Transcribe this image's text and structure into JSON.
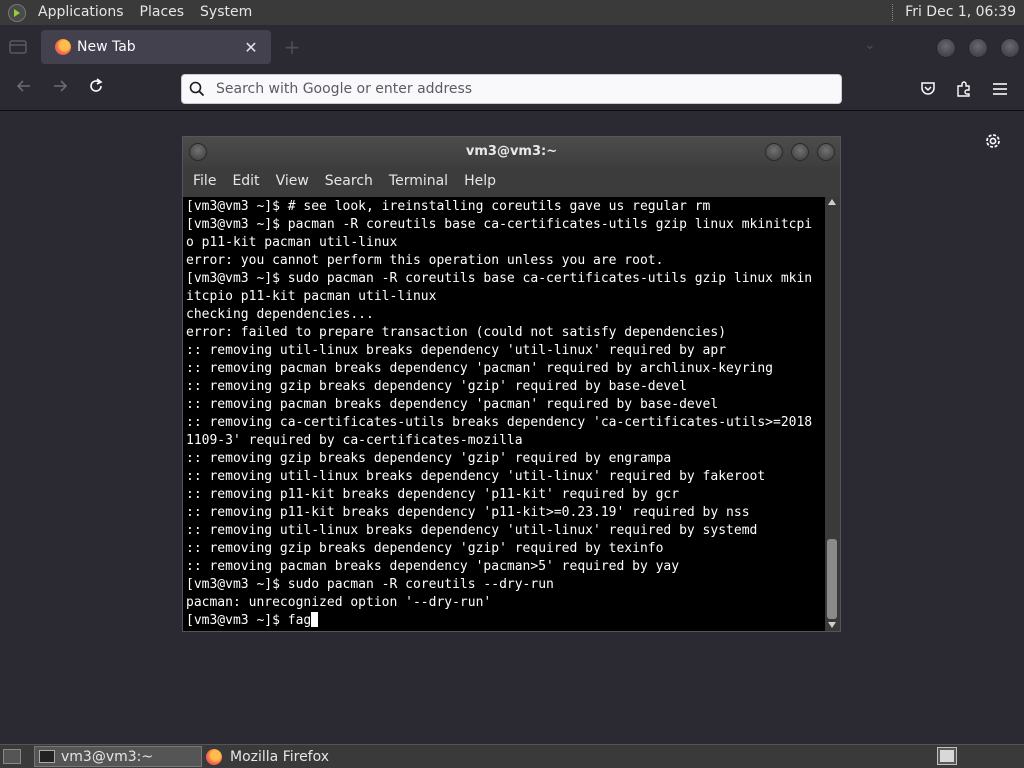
{
  "top_panel": {
    "menus": [
      "Applications",
      "Places",
      "System"
    ],
    "clock": "Fri Dec 1, 06:39"
  },
  "browser": {
    "tab_title": "New Tab",
    "urlbar_placeholder": "Search with Google or enter address"
  },
  "terminal": {
    "title": "vm3@vm3:~",
    "menu": [
      "File",
      "Edit",
      "View",
      "Search",
      "Terminal",
      "Help"
    ],
    "lines": [
      "[vm3@vm3 ~]$ # see look, ireinstalling coreutils gave us regular rm",
      "[vm3@vm3 ~]$ pacman -R coreutils base ca-certificates-utils gzip linux mkinitcpi",
      "o p11-kit pacman util-linux",
      "error: you cannot perform this operation unless you are root.",
      "[vm3@vm3 ~]$ sudo pacman -R coreutils base ca-certificates-utils gzip linux mkin",
      "itcpio p11-kit pacman util-linux",
      "checking dependencies...",
      "error: failed to prepare transaction (could not satisfy dependencies)",
      ":: removing util-linux breaks dependency 'util-linux' required by apr",
      ":: removing pacman breaks dependency 'pacman' required by archlinux-keyring",
      ":: removing gzip breaks dependency 'gzip' required by base-devel",
      ":: removing pacman breaks dependency 'pacman' required by base-devel",
      ":: removing ca-certificates-utils breaks dependency 'ca-certificates-utils>=2018",
      "1109-3' required by ca-certificates-mozilla",
      ":: removing gzip breaks dependency 'gzip' required by engrampa",
      ":: removing util-linux breaks dependency 'util-linux' required by fakeroot",
      ":: removing p11-kit breaks dependency 'p11-kit' required by gcr",
      ":: removing p11-kit breaks dependency 'p11-kit>=0.23.19' required by nss",
      ":: removing util-linux breaks dependency 'util-linux' required by systemd",
      ":: removing gzip breaks dependency 'gzip' required by texinfo",
      ":: removing pacman breaks dependency 'pacman>5' required by yay",
      "[vm3@vm3 ~]$ sudo pacman -R coreutils --dry-run",
      "pacman: unrecognized option '--dry-run'"
    ],
    "prompt_line": "[vm3@vm3 ~]$ fag"
  },
  "taskbar": {
    "tasks": [
      "vm3@vm3:~",
      "Mozilla Firefox"
    ]
  }
}
